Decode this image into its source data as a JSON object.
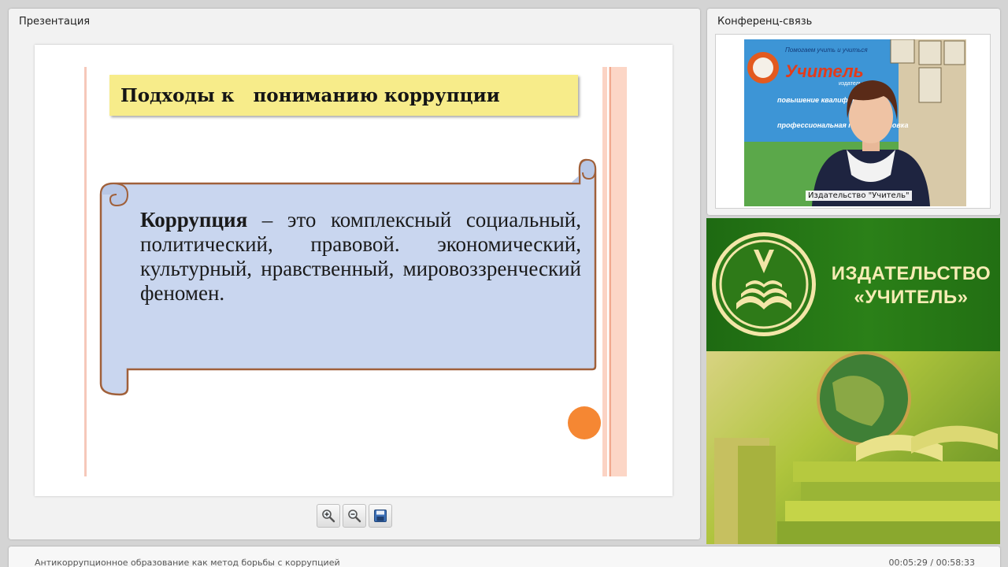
{
  "presentation": {
    "panel_title": "Презентация",
    "slide": {
      "title": "Подходы к   пониманию коррупции",
      "term": "Коррупция",
      "definition": " – это комплексный социальный, политический, правовой. экономический, культурный, нравственный, мировоззренческий феномен."
    },
    "toolbar": {
      "zoom_in_icon": "zoom-in-icon",
      "zoom_out_icon": "zoom-out-icon",
      "save_icon": "save-icon"
    }
  },
  "conference": {
    "panel_title": "Конференц-связь",
    "video_label": "Издательство \"Учитель\"",
    "video_backdrop": {
      "line1": "Помогаем учить и учиться",
      "brand": "Учитель",
      "sub": "издательство",
      "item1": "повышение квалификации",
      "item2": "профессиональная переподготовка"
    }
  },
  "banner": {
    "name_line1": "ИЗДАТЕЛЬСТВО",
    "name_line2": "«УЧИТЕЛЬ»"
  },
  "footer": {
    "title": "Антикоррупционное образование как метод борьбы с коррупцией",
    "time": "00:05:29 / 00:58:33"
  },
  "colors": {
    "banner_green": "#2b8018",
    "slide_title_bg": "#f7ec8a",
    "scroll_fill": "#c9d6ef",
    "scroll_border": "#a0603a",
    "accent_orange": "#f58733"
  }
}
